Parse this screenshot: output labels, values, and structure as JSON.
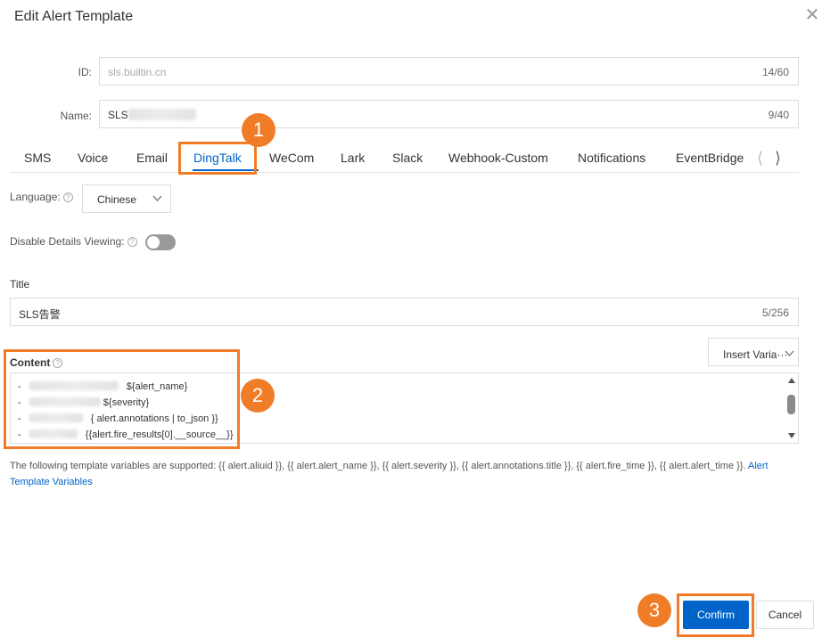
{
  "dialog": {
    "title": "Edit Alert Template"
  },
  "form": {
    "id_label": "ID:",
    "id_value": "sls.builtin.cn",
    "id_count": "14/60",
    "name_label": "Name:",
    "name_value": "SLS",
    "name_count": "9/40"
  },
  "tabs": [
    {
      "label": "SMS"
    },
    {
      "label": "Voice"
    },
    {
      "label": "Email"
    },
    {
      "label": "DingTalk"
    },
    {
      "label": "WeCom"
    },
    {
      "label": "Lark"
    },
    {
      "label": "Slack"
    },
    {
      "label": "Webhook-Custom"
    },
    {
      "label": "Notifications"
    },
    {
      "label": "EventBridge"
    }
  ],
  "active_tab": "DingTalk",
  "language": {
    "label": "Language:",
    "value": "Chinese"
  },
  "details": {
    "label": "Disable Details Viewing:",
    "enabled": false
  },
  "title_field": {
    "label": "Title",
    "value": "SLS告警",
    "count": "5/256"
  },
  "content": {
    "label": "Content",
    "insert_variable": "Insert Varia···",
    "lines": [
      {
        "prefix": "-",
        "text": "${alert_name}"
      },
      {
        "prefix": "-",
        "text": "${severity}"
      },
      {
        "prefix": "-",
        "text": "{ alert.annotations | to_json }}"
      },
      {
        "prefix": "-",
        "text": "{{alert.fire_results[0].__source__}}"
      }
    ]
  },
  "hint": {
    "text": "The following template variables are supported: {{ alert.aliuid }}, {{ alert.alert_name }}, {{ alert.severity }}, {{ alert.annotations.title }}, {{ alert.fire_time }}, {{ alert.alert_time }}.",
    "link": "Alert Template Variables"
  },
  "buttons": {
    "confirm": "Confirm",
    "cancel": "Cancel"
  },
  "annotations": {
    "badge_1": "1",
    "badge_2": "2",
    "badge_3": "3",
    "highlight_color": "#f07c28"
  },
  "colors": {
    "primary": "#0064c8"
  },
  "icons": {
    "close": "close-icon",
    "help": "help-icon",
    "chevron": "chevron-down-icon",
    "tab_prev": "chevron-left-icon",
    "tab_next": "chevron-right-icon"
  }
}
